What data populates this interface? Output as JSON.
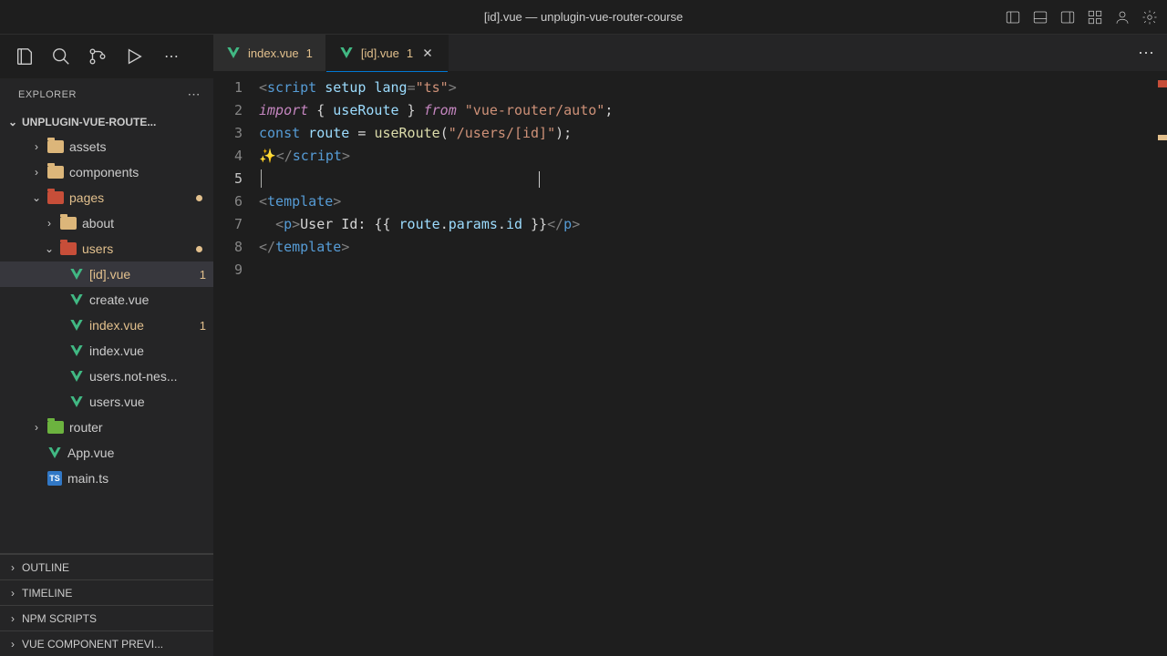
{
  "titlebar": {
    "title": "[id].vue — unplugin-vue-router-course"
  },
  "sidebar": {
    "header": "EXPLORER",
    "project": "UNPLUGIN-VUE-ROUTE...",
    "tree": {
      "assets": "assets",
      "components": "components",
      "pages": "pages",
      "about": "about",
      "users": "users",
      "id_vue": "[id].vue",
      "id_vue_badge": "1",
      "create_vue": "create.vue",
      "users_index_vue": "index.vue",
      "users_index_vue_badge": "1",
      "pages_index_vue": "index.vue",
      "users_not_nes": "users.not-nes...",
      "users_vue": "users.vue",
      "router": "router",
      "app_vue": "App.vue",
      "main_ts": "main.ts"
    },
    "sections": {
      "outline": "OUTLINE",
      "timeline": "TIMELINE",
      "npm_scripts": "NPM SCRIPTS",
      "vue_preview": "VUE COMPONENT PREVI..."
    }
  },
  "tabs": {
    "tab1": {
      "label": "index.vue",
      "badge": "1"
    },
    "tab2": {
      "label": "[id].vue",
      "badge": "1"
    }
  },
  "code": {
    "lines": [
      "1",
      "2",
      "3",
      "4",
      "5",
      "6",
      "7",
      "8",
      "9"
    ],
    "l1_open": "<",
    "l1_tag": "script",
    "l1_setup": " setup",
    "l1_lang": " lang",
    "l1_eq": "=",
    "l1_ts": "\"ts\"",
    "l1_close": ">",
    "l2_import": "import",
    "l2_b1": " { ",
    "l2_use": "useRoute",
    "l2_b2": " } ",
    "l2_from": "from",
    "l2_mod": " \"vue-router/auto\"",
    "l2_semi": ";",
    "l3_const": "const",
    "l3_route": " route ",
    "l3_eq": "= ",
    "l3_fn": "useRoute",
    "l3_p1": "(",
    "l3_arg": "\"/users/[id]\"",
    "l3_p2": ");",
    "l4_sparkle": "✨",
    "l4_close_open": "</",
    "l4_tag": "script",
    "l4_close": ">",
    "l6_open": "<",
    "l6_tag": "template",
    "l6_close": ">",
    "l7_indent": "  ",
    "l7_popen": "<",
    "l7_p": "p",
    "l7_pclose": ">",
    "l7_text": "User Id: ",
    "l7_expr_open": "{{ ",
    "l7_route": "route",
    "l7_dot1": ".",
    "l7_params": "params",
    "l7_dot2": ".",
    "l7_id": "id",
    "l7_expr_close": " }}",
    "l7_pend_open": "</",
    "l7_pend": "p",
    "l7_pend_close": ">",
    "l8_open": "</",
    "l8_tag": "template",
    "l8_close": ">"
  }
}
